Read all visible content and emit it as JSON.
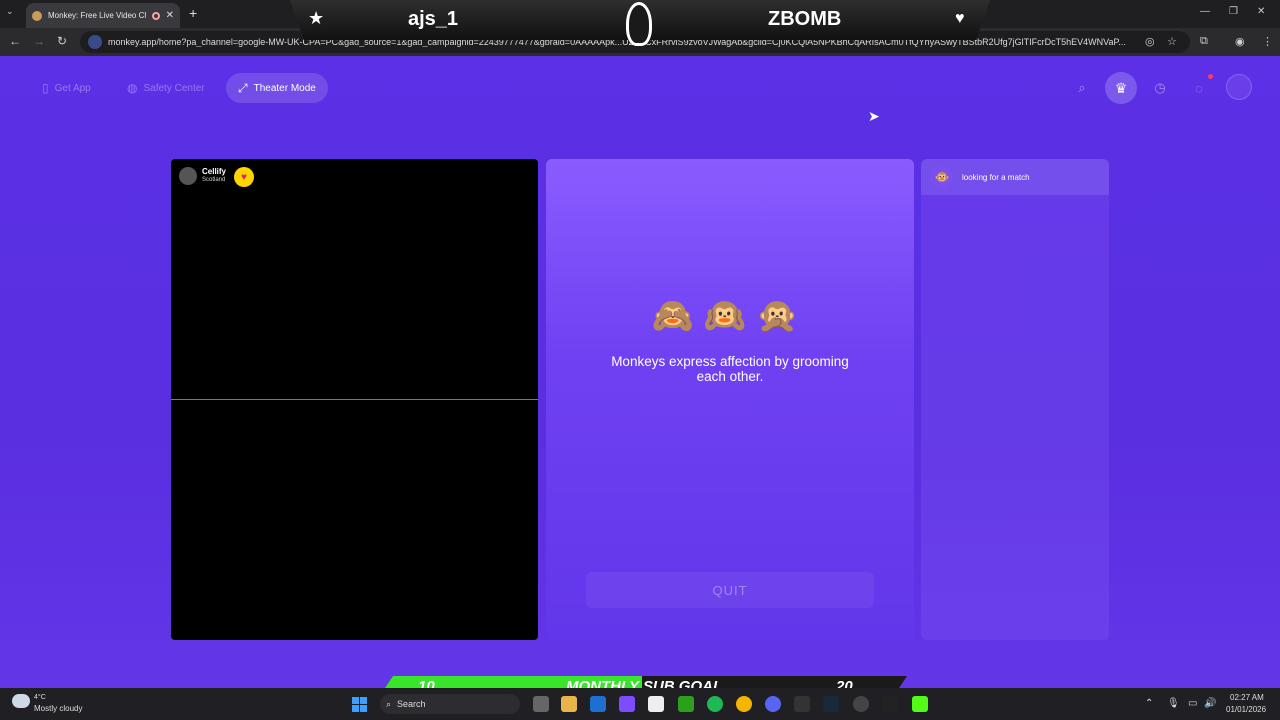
{
  "browser": {
    "tab_title": "Monkey: Free Live Video Ch",
    "url": "monkey.app/home?pa_channel=google-MW-UK-CPA=PC&gad_source=1&gad_campaignid=22439777477&gbraid=0AAAAApk...UZLBCxFRrviS9zvoVJWagAb&gclid=Cj0KCQiA5NPKBhCqARIsACm0TfQYhyASwyTBStbR2Ufg7jGlTIFcrDcT5hEV4WNVaP..."
  },
  "stream_overlay": {
    "left_name": "ajs_1",
    "right_name": "ZBOMB"
  },
  "header": {
    "get_app": "Get App",
    "safety_center": "Safety Center",
    "theater_mode": "Theater Mode"
  },
  "video": {
    "user_name": "Cellify",
    "user_location": "Scotland"
  },
  "center": {
    "emojis": "🙈🙉🙊",
    "fact": "Monkeys express affection by grooming each other.",
    "quit": "QUIT"
  },
  "chat": {
    "status": "looking for a match",
    "avatar_emoji": "🐵"
  },
  "subgoal": {
    "current": "10",
    "label": "MONTHLY SUB GOAL",
    "target": "20",
    "progress": 0.5
  },
  "taskbar": {
    "temperature": "4°C",
    "weather": "Mostly cloudy",
    "search": "Search",
    "time": "02:27 AM",
    "date": "01/01/2026"
  },
  "colors": {
    "page_bg": "#5a2fe0",
    "panel_top": "#8a5cff",
    "subgoal_fill": "#38e52a",
    "badge_yellow": "#ffd400"
  }
}
